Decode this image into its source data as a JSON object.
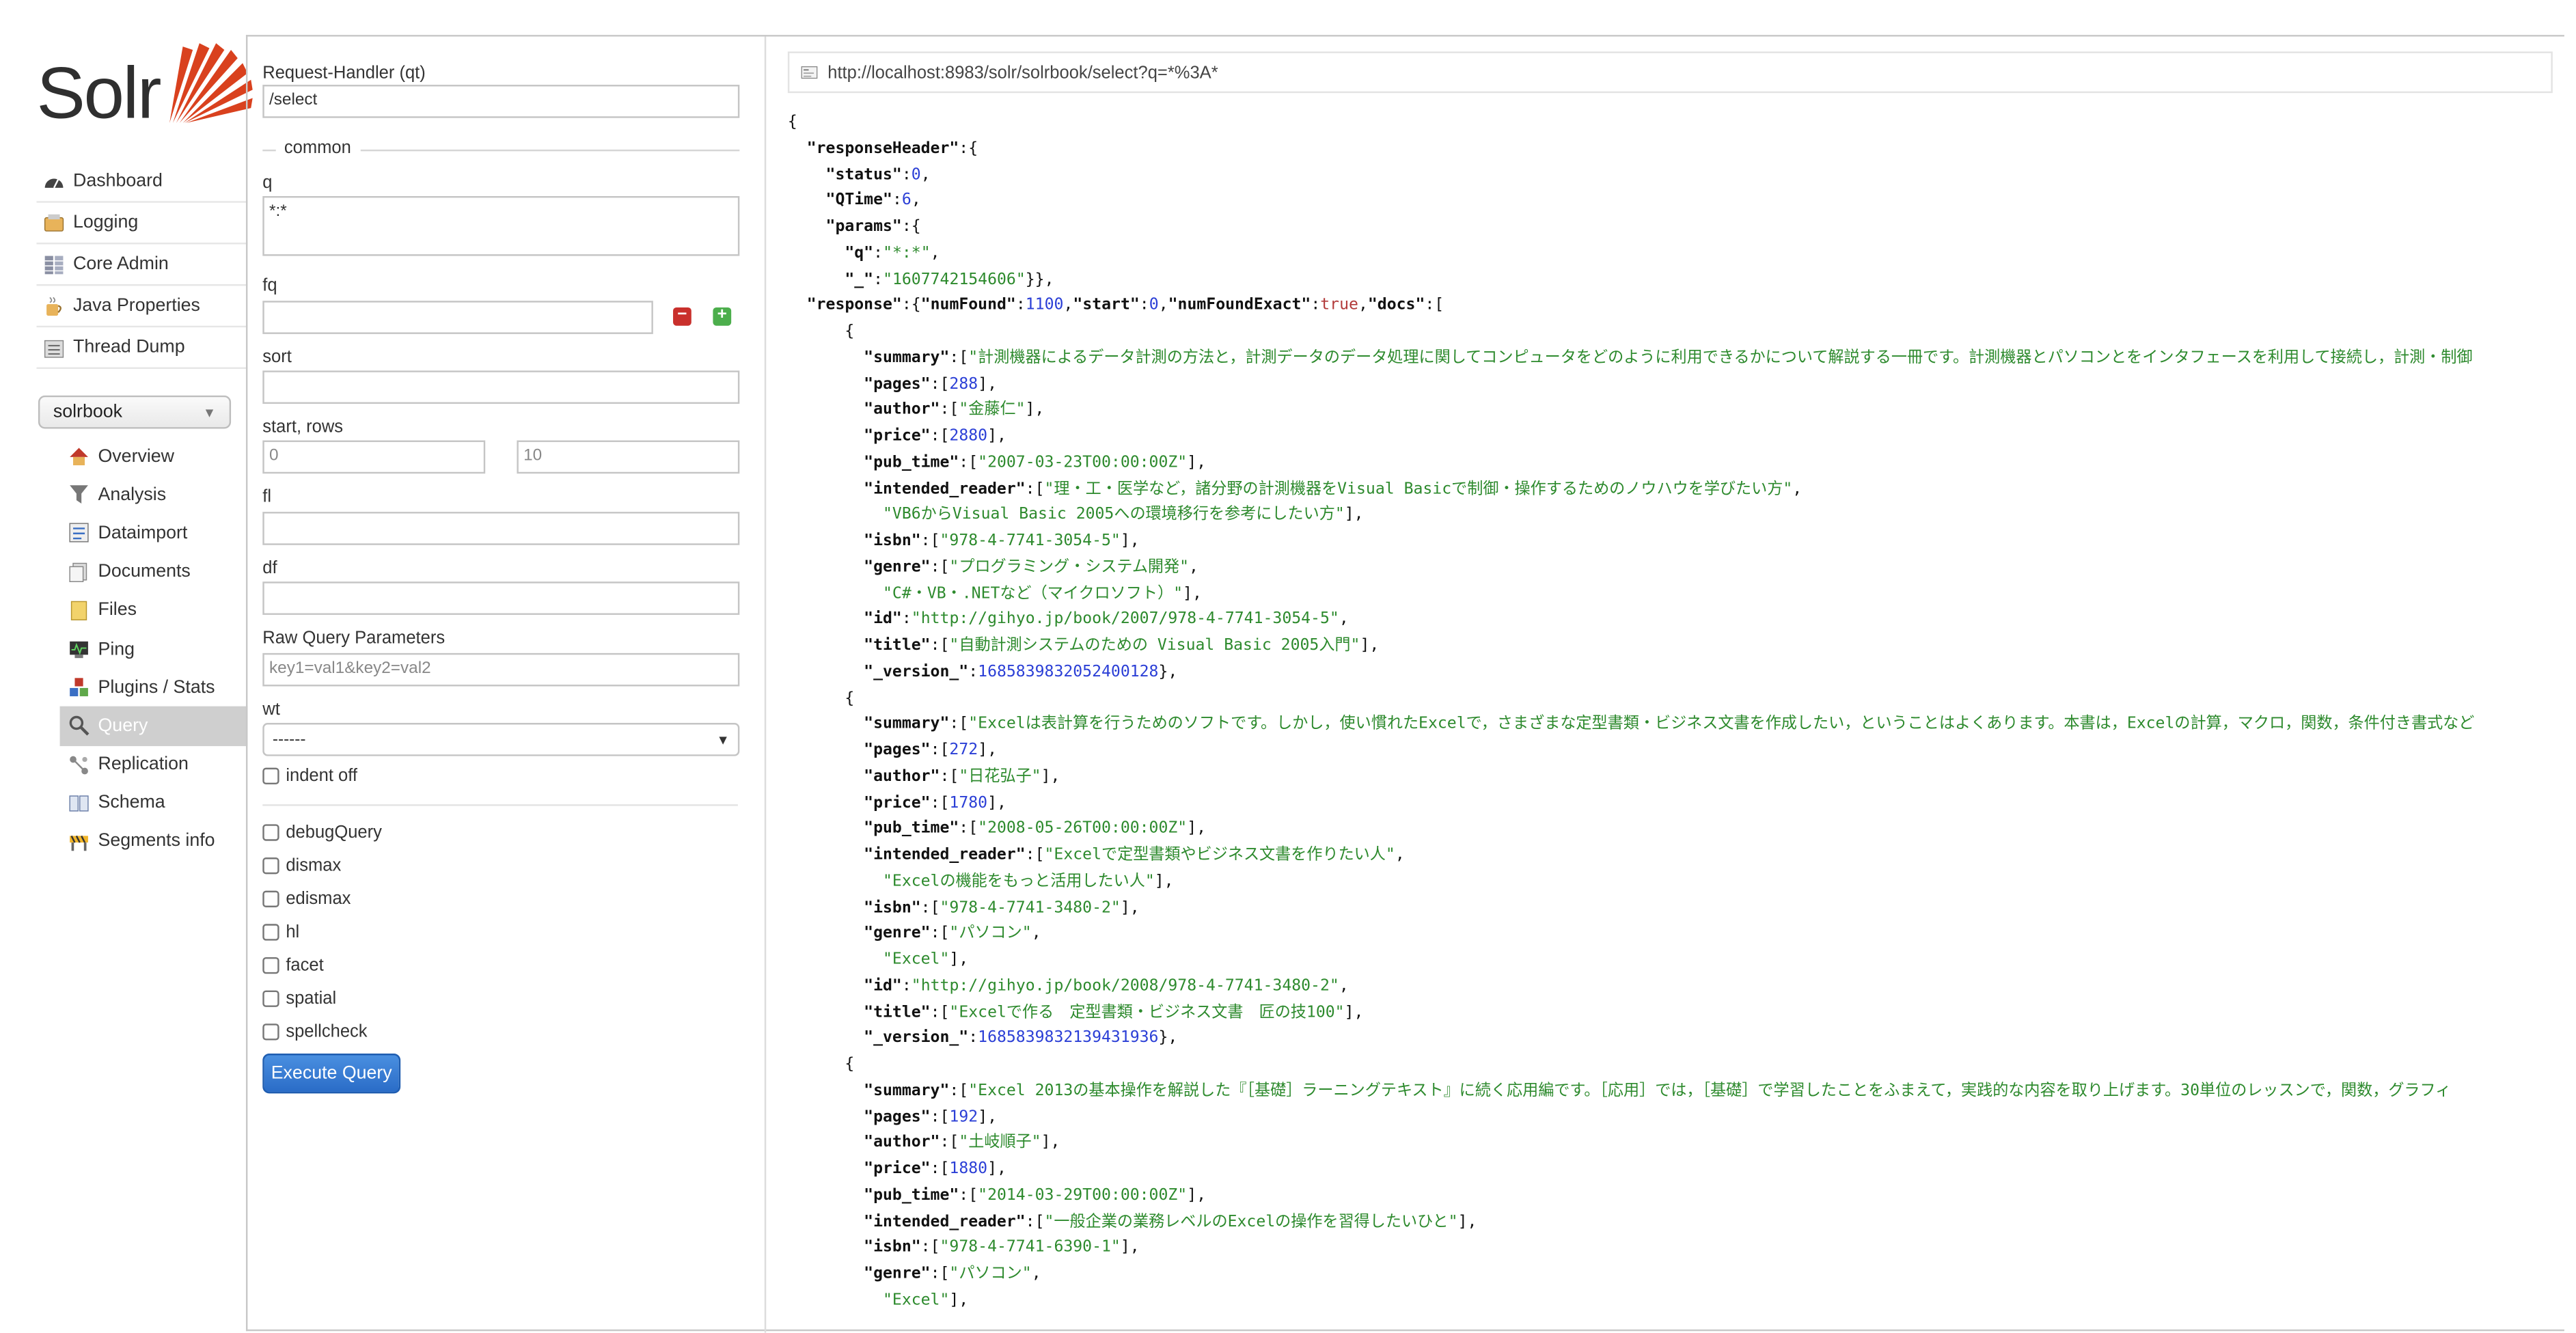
{
  "logo": {
    "text": "Solr"
  },
  "main_nav": [
    "Dashboard",
    "Logging",
    "Core Admin",
    "Java Properties",
    "Thread Dump"
  ],
  "core_selector": {
    "value": "solrbook"
  },
  "core_nav": [
    "Overview",
    "Analysis",
    "Dataimport",
    "Documents",
    "Files",
    "Ping",
    "Plugins / Stats",
    "Query",
    "Replication",
    "Schema",
    "Segments info"
  ],
  "form": {
    "request_handler_label": "Request-Handler (qt)",
    "request_handler_value": "/select",
    "common_legend": "common",
    "q_label": "q",
    "q_value": "*:*",
    "fq_label": "fq",
    "fq_value": "",
    "sort_label": "sort",
    "sort_value": "",
    "start_rows_label": "start, rows",
    "start_value": "0",
    "rows_value": "10",
    "fl_label": "fl",
    "fl_value": "",
    "df_label": "df",
    "df_value": "",
    "raw_label": "Raw Query Parameters",
    "raw_placeholder": "key1=val1&key2=val2",
    "wt_label": "wt",
    "wt_value": "------",
    "indent_label": "indent off",
    "options": [
      "debugQuery",
      "dismax",
      "edismax",
      "hl",
      "facet",
      "spatial",
      "spellcheck"
    ],
    "execute_label": "Execute Query"
  },
  "result": {
    "url": "http://localhost:8983/solr/solrbook/select?q=*%3A*",
    "json_lines": [
      [
        [
          "p",
          "{"
        ]
      ],
      [
        [
          "p",
          "  "
        ],
        [
          "k",
          "\"responseHeader\""
        ],
        [
          "p",
          ":{"
        ]
      ],
      [
        [
          "p",
          "    "
        ],
        [
          "k",
          "\"status\""
        ],
        [
          "p",
          ":"
        ],
        [
          "n",
          "0"
        ],
        [
          "p",
          ","
        ]
      ],
      [
        [
          "p",
          "    "
        ],
        [
          "k",
          "\"QTime\""
        ],
        [
          "p",
          ":"
        ],
        [
          "n",
          "6"
        ],
        [
          "p",
          ","
        ]
      ],
      [
        [
          "p",
          "    "
        ],
        [
          "k",
          "\"params\""
        ],
        [
          "p",
          ":{"
        ]
      ],
      [
        [
          "p",
          "      "
        ],
        [
          "k",
          "\"q\""
        ],
        [
          "p",
          ":"
        ],
        [
          "s",
          "\"*:*\""
        ],
        [
          "p",
          ","
        ]
      ],
      [
        [
          "p",
          "      "
        ],
        [
          "k",
          "\"_\""
        ],
        [
          "p",
          ":"
        ],
        [
          "s",
          "\"1607742154606\""
        ],
        [
          "p",
          "}},"
        ]
      ],
      [
        [
          "p",
          "  "
        ],
        [
          "k",
          "\"response\""
        ],
        [
          "p",
          ":{"
        ],
        [
          "k",
          "\"numFound\""
        ],
        [
          "p",
          ":"
        ],
        [
          "n",
          "1100"
        ],
        [
          "p",
          ","
        ],
        [
          "k",
          "\"start\""
        ],
        [
          "p",
          ":"
        ],
        [
          "n",
          "0"
        ],
        [
          "p",
          ","
        ],
        [
          "k",
          "\"numFoundExact\""
        ],
        [
          "p",
          ":"
        ],
        [
          "b",
          "true"
        ],
        [
          "p",
          ","
        ],
        [
          "k",
          "\"docs\""
        ],
        [
          "p",
          ":["
        ]
      ],
      [
        [
          "p",
          "      {"
        ]
      ],
      [
        [
          "p",
          "        "
        ],
        [
          "k",
          "\"summary\""
        ],
        [
          "p",
          ":["
        ],
        [
          "s",
          "\"計測機器によるデータ計測の方法と，計測データのデータ処理に関してコンピュータをどのように利用できるかについて解説する一冊です。計測機器とパソコンとをインタフェースを利用して接続し，計測・制御"
        ]
      ],
      [
        [
          "p",
          "        "
        ],
        [
          "k",
          "\"pages\""
        ],
        [
          "p",
          ":["
        ],
        [
          "n",
          "288"
        ],
        [
          "p",
          "],"
        ]
      ],
      [
        [
          "p",
          "        "
        ],
        [
          "k",
          "\"author\""
        ],
        [
          "p",
          ":["
        ],
        [
          "s",
          "\"金藤仁\""
        ],
        [
          "p",
          "],"
        ]
      ],
      [
        [
          "p",
          "        "
        ],
        [
          "k",
          "\"price\""
        ],
        [
          "p",
          ":["
        ],
        [
          "n",
          "2880"
        ],
        [
          "p",
          "],"
        ]
      ],
      [
        [
          "p",
          "        "
        ],
        [
          "k",
          "\"pub_time\""
        ],
        [
          "p",
          ":["
        ],
        [
          "s",
          "\"2007-03-23T00:00:00Z\""
        ],
        [
          "p",
          "],"
        ]
      ],
      [
        [
          "p",
          "        "
        ],
        [
          "k",
          "\"intended_reader\""
        ],
        [
          "p",
          ":["
        ],
        [
          "s",
          "\"理・工・医学など，諸分野の計測機器をVisual Basicで制御・操作するためのノウハウを学びたい方\""
        ],
        [
          "p",
          ","
        ]
      ],
      [
        [
          "p",
          "          "
        ],
        [
          "s",
          "\"VB6からVisual Basic 2005への環境移行を参考にしたい方\""
        ],
        [
          "p",
          "],"
        ]
      ],
      [
        [
          "p",
          "        "
        ],
        [
          "k",
          "\"isbn\""
        ],
        [
          "p",
          ":["
        ],
        [
          "s",
          "\"978-4-7741-3054-5\""
        ],
        [
          "p",
          "],"
        ]
      ],
      [
        [
          "p",
          "        "
        ],
        [
          "k",
          "\"genre\""
        ],
        [
          "p",
          ":["
        ],
        [
          "s",
          "\"プログラミング・システム開発\""
        ],
        [
          "p",
          ","
        ]
      ],
      [
        [
          "p",
          "          "
        ],
        [
          "s",
          "\"C#・VB・.NETなど（マイクロソフト）\""
        ],
        [
          "p",
          "],"
        ]
      ],
      [
        [
          "p",
          "        "
        ],
        [
          "k",
          "\"id\""
        ],
        [
          "p",
          ":"
        ],
        [
          "s",
          "\"http://gihyo.jp/book/2007/978-4-7741-3054-5\""
        ],
        [
          "p",
          ","
        ]
      ],
      [
        [
          "p",
          "        "
        ],
        [
          "k",
          "\"title\""
        ],
        [
          "p",
          ":["
        ],
        [
          "s",
          "\"自動計測システムのための Visual Basic 2005入門\""
        ],
        [
          "p",
          "],"
        ]
      ],
      [
        [
          "p",
          "        "
        ],
        [
          "k",
          "\"_version_\""
        ],
        [
          "p",
          ":"
        ],
        [
          "n",
          "1685839832052400128"
        ],
        [
          "p",
          "},"
        ]
      ],
      [
        [
          "p",
          "      {"
        ]
      ],
      [
        [
          "p",
          "        "
        ],
        [
          "k",
          "\"summary\""
        ],
        [
          "p",
          ":["
        ],
        [
          "s",
          "\"Excelは表計算を行うためのソフトです。しかし，使い慣れたExcelで，さまざまな定型書類・ビジネス文書を作成したい，ということはよくあります。本書は，Excelの計算，マクロ，関数，条件付き書式など"
        ]
      ],
      [
        [
          "p",
          "        "
        ],
        [
          "k",
          "\"pages\""
        ],
        [
          "p",
          ":["
        ],
        [
          "n",
          "272"
        ],
        [
          "p",
          "],"
        ]
      ],
      [
        [
          "p",
          "        "
        ],
        [
          "k",
          "\"author\""
        ],
        [
          "p",
          ":["
        ],
        [
          "s",
          "\"日花弘子\""
        ],
        [
          "p",
          "],"
        ]
      ],
      [
        [
          "p",
          "        "
        ],
        [
          "k",
          "\"price\""
        ],
        [
          "p",
          ":["
        ],
        [
          "n",
          "1780"
        ],
        [
          "p",
          "],"
        ]
      ],
      [
        [
          "p",
          "        "
        ],
        [
          "k",
          "\"pub_time\""
        ],
        [
          "p",
          ":["
        ],
        [
          "s",
          "\"2008-05-26T00:00:00Z\""
        ],
        [
          "p",
          "],"
        ]
      ],
      [
        [
          "p",
          "        "
        ],
        [
          "k",
          "\"intended_reader\""
        ],
        [
          "p",
          ":["
        ],
        [
          "s",
          "\"Excelで定型書類やビジネス文書を作りたい人\""
        ],
        [
          "p",
          ","
        ]
      ],
      [
        [
          "p",
          "          "
        ],
        [
          "s",
          "\"Excelの機能をもっと活用したい人\""
        ],
        [
          "p",
          "],"
        ]
      ],
      [
        [
          "p",
          "        "
        ],
        [
          "k",
          "\"isbn\""
        ],
        [
          "p",
          ":["
        ],
        [
          "s",
          "\"978-4-7741-3480-2\""
        ],
        [
          "p",
          "],"
        ]
      ],
      [
        [
          "p",
          "        "
        ],
        [
          "k",
          "\"genre\""
        ],
        [
          "p",
          ":["
        ],
        [
          "s",
          "\"パソコン\""
        ],
        [
          "p",
          ","
        ]
      ],
      [
        [
          "p",
          "          "
        ],
        [
          "s",
          "\"Excel\""
        ],
        [
          "p",
          "],"
        ]
      ],
      [
        [
          "p",
          "        "
        ],
        [
          "k",
          "\"id\""
        ],
        [
          "p",
          ":"
        ],
        [
          "s",
          "\"http://gihyo.jp/book/2008/978-4-7741-3480-2\""
        ],
        [
          "p",
          ","
        ]
      ],
      [
        [
          "p",
          "        "
        ],
        [
          "k",
          "\"title\""
        ],
        [
          "p",
          ":["
        ],
        [
          "s",
          "\"Excelで作る　定型書類・ビジネス文書　匠の技100\""
        ],
        [
          "p",
          "],"
        ]
      ],
      [
        [
          "p",
          "        "
        ],
        [
          "k",
          "\"_version_\""
        ],
        [
          "p",
          ":"
        ],
        [
          "n",
          "1685839832139431936"
        ],
        [
          "p",
          "},"
        ]
      ],
      [
        [
          "p",
          "      {"
        ]
      ],
      [
        [
          "p",
          "        "
        ],
        [
          "k",
          "\"summary\""
        ],
        [
          "p",
          ":["
        ],
        [
          "s",
          "\"Excel 2013の基本操作を解説した『［基礎］ラーニングテキスト』に続く応用編です。［応用］では，［基礎］で学習したことをふまえて，実践的な内容を取り上げます。30単位のレッスンで，関数，グラフィ"
        ]
      ],
      [
        [
          "p",
          "        "
        ],
        [
          "k",
          "\"pages\""
        ],
        [
          "p",
          ":["
        ],
        [
          "n",
          "192"
        ],
        [
          "p",
          "],"
        ]
      ],
      [
        [
          "p",
          "        "
        ],
        [
          "k",
          "\"author\""
        ],
        [
          "p",
          ":["
        ],
        [
          "s",
          "\"土岐順子\""
        ],
        [
          "p",
          "],"
        ]
      ],
      [
        [
          "p",
          "        "
        ],
        [
          "k",
          "\"price\""
        ],
        [
          "p",
          ":["
        ],
        [
          "n",
          "1880"
        ],
        [
          "p",
          "],"
        ]
      ],
      [
        [
          "p",
          "        "
        ],
        [
          "k",
          "\"pub_time\""
        ],
        [
          "p",
          ":["
        ],
        [
          "s",
          "\"2014-03-29T00:00:00Z\""
        ],
        [
          "p",
          "],"
        ]
      ],
      [
        [
          "p",
          "        "
        ],
        [
          "k",
          "\"intended_reader\""
        ],
        [
          "p",
          ":["
        ],
        [
          "s",
          "\"一般企業の業務レベルのExcelの操作を習得したいひと\""
        ],
        [
          "p",
          "],"
        ]
      ],
      [
        [
          "p",
          "        "
        ],
        [
          "k",
          "\"isbn\""
        ],
        [
          "p",
          ":["
        ],
        [
          "s",
          "\"978-4-7741-6390-1\""
        ],
        [
          "p",
          "],"
        ]
      ],
      [
        [
          "p",
          "        "
        ],
        [
          "k",
          "\"genre\""
        ],
        [
          "p",
          ":["
        ],
        [
          "s",
          "\"パソコン\""
        ],
        [
          "p",
          ","
        ]
      ],
      [
        [
          "p",
          "          "
        ],
        [
          "s",
          "\"Excel\""
        ],
        [
          "p",
          "],"
        ]
      ]
    ]
  },
  "colors": {
    "accent": "#d9411e",
    "string": "#2d8a2d",
    "number": "#2b3fd6",
    "boolean": "#b23a3a",
    "button": "#2a6cc7"
  }
}
